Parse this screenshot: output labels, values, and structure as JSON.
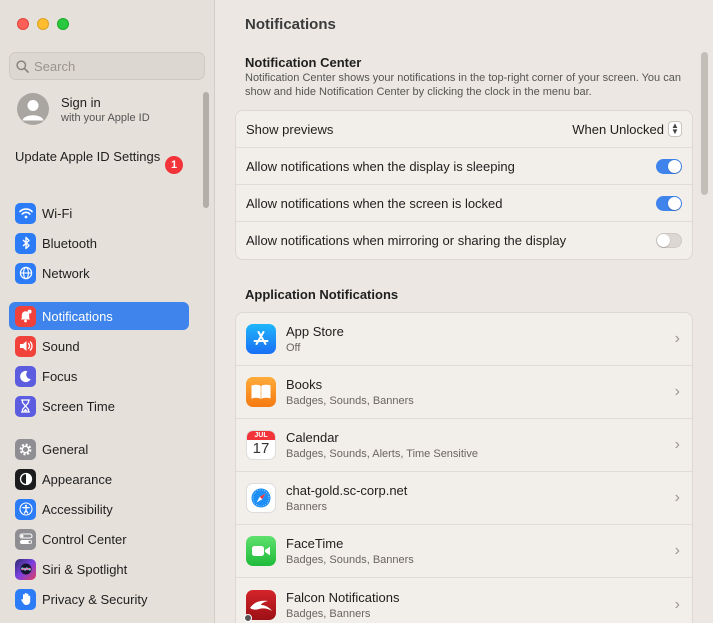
{
  "sidebar": {
    "search_placeholder": "Search",
    "account": {
      "name": "Sign in",
      "sub": "with your Apple ID"
    },
    "update": {
      "label": "Update Apple ID Settings",
      "badge": "1"
    },
    "items": [
      {
        "label": "Wi-Fi",
        "icon": "wifi-icon",
        "color": "#2b7cf6"
      },
      {
        "label": "Bluetooth",
        "icon": "bluetooth-icon",
        "color": "#2b7cf6"
      },
      {
        "label": "Network",
        "icon": "globe-icon",
        "color": "#2b7cf6"
      },
      {
        "label": "Notifications",
        "icon": "bell-icon",
        "color": "#f0413a"
      },
      {
        "label": "Sound",
        "icon": "speaker-icon",
        "color": "#f0413a"
      },
      {
        "label": "Focus",
        "icon": "moon-icon",
        "color": "#5b5ce0"
      },
      {
        "label": "Screen Time",
        "icon": "hourglass-icon",
        "color": "#5b5ce0"
      },
      {
        "label": "General",
        "icon": "gear-icon",
        "color": "#8e8e93"
      },
      {
        "label": "Appearance",
        "icon": "appearance-icon",
        "color": "#1c1c1e"
      },
      {
        "label": "Accessibility",
        "icon": "accessibility-icon",
        "color": "#2b7cf6"
      },
      {
        "label": "Control Center",
        "icon": "control-center-icon",
        "color": "#8e8e93"
      },
      {
        "label": "Siri & Spotlight",
        "icon": "siri-icon",
        "color": "#7b3fe4"
      },
      {
        "label": "Privacy & Security",
        "icon": "hand-icon",
        "color": "#2b7cf6"
      }
    ],
    "active": "Notifications"
  },
  "main": {
    "title": "Notifications",
    "notification_center": {
      "heading": "Notification Center",
      "description": "Notification Center shows your notifications in the top-right corner of your screen. You can show and hide Notification Center by clicking the clock in the menu bar.",
      "rows": [
        {
          "label": "Show previews",
          "value": "When Unlocked"
        },
        {
          "label": "Allow notifications when the display is sleeping",
          "on": true
        },
        {
          "label": "Allow notifications when the screen is locked",
          "on": true
        },
        {
          "label": "Allow notifications when mirroring or sharing the display",
          "on": false
        }
      ]
    },
    "app_notifications": {
      "heading": "Application Notifications",
      "apps": [
        {
          "name": "App Store",
          "detail": "Off",
          "icon": "app-store-icon"
        },
        {
          "name": "Books",
          "detail": "Badges, Sounds, Banners",
          "icon": "books-icon"
        },
        {
          "name": "Calendar",
          "detail": "Badges, Sounds, Alerts, Time Sensitive",
          "icon": "calendar-icon",
          "month": "JUL",
          "day": "17"
        },
        {
          "name": "chat-gold.sc-corp.net",
          "detail": "Banners",
          "icon": "safari-icon"
        },
        {
          "name": "FaceTime",
          "detail": "Badges, Sounds, Banners",
          "icon": "facetime-icon"
        },
        {
          "name": "Falcon Notifications",
          "detail": "Badges, Banners",
          "icon": "falcon-icon"
        }
      ]
    }
  }
}
